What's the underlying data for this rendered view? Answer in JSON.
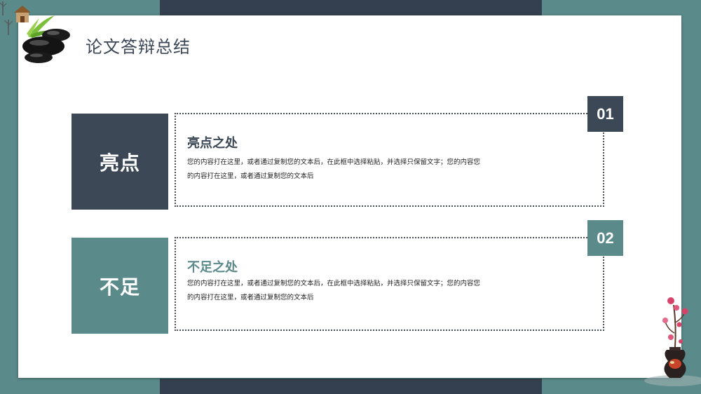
{
  "page": {
    "title": "论文答辩总结"
  },
  "sections": [
    {
      "label": "亮点",
      "number": "01",
      "heading": "亮点之处",
      "body_line1": "您的内容打在这里，或者通过复制您的文本后，在此框中选择粘贴，并选择只保留文字；您的内容您",
      "body_line2": "的内容打在这里，或者通过复制您的文本后"
    },
    {
      "label": "不足",
      "number": "02",
      "heading": "不足之处",
      "body_line1": "您的内容打在这里，或者通过复制您的文本后，在此框中选择粘贴，并选择只保留文字；您的内容您",
      "body_line2": "的内容打在这里，或者通过复制您的文本后"
    }
  ],
  "colors": {
    "dark_slate": "#3d4856",
    "teal": "#5b8a8a",
    "band": "#34404f"
  },
  "icons": {
    "top_left": "stones-bamboo-icon",
    "bottom_right": "plum-blossom-vase-icon"
  }
}
